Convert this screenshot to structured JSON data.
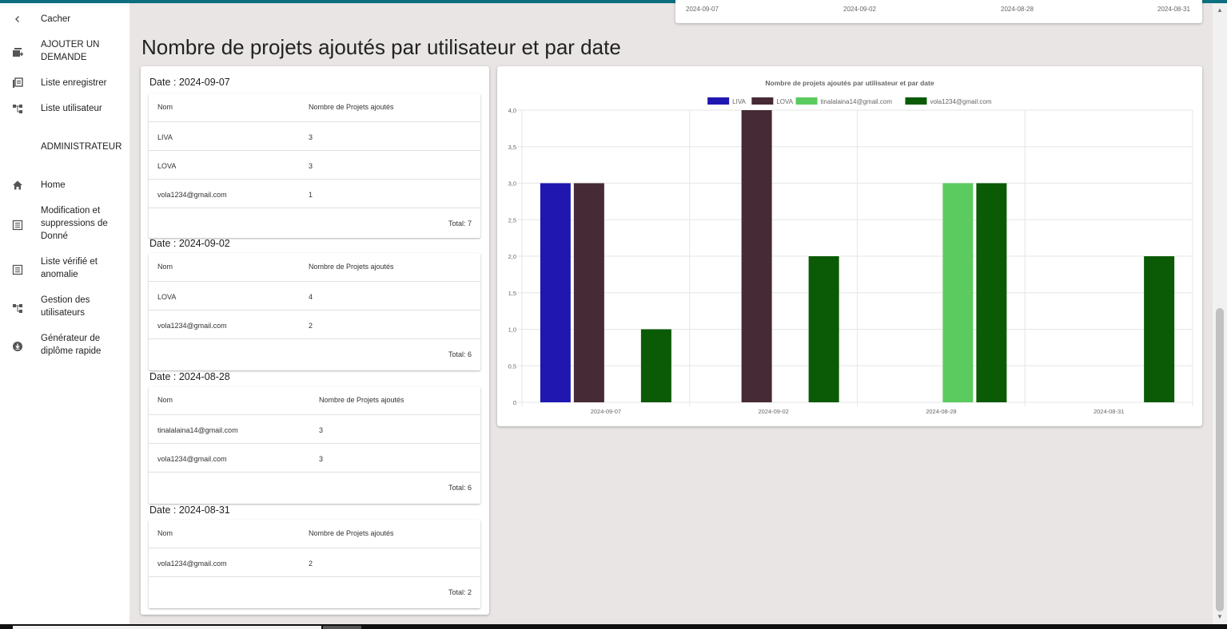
{
  "sidebar": {
    "items": [
      {
        "label": "Cacher",
        "icon": "chevron-left-icon"
      },
      {
        "label": "AJOUTER UN DEMANDE",
        "icon": "add-request-icon"
      },
      {
        "label": "Liste enregistrer",
        "icon": "list-icon"
      },
      {
        "label": "Liste utilisateur",
        "icon": "hierarchy-icon"
      },
      {
        "label": "ADMINISTRATEUR",
        "icon": ""
      },
      {
        "label": "Home",
        "icon": "home-icon"
      },
      {
        "label": "Modification et suppressions de Donné",
        "icon": "edit-list-icon"
      },
      {
        "label": "Liste vérifié et anomalie",
        "icon": "checked-list-icon"
      },
      {
        "label": "Gestion des utilisateurs",
        "icon": "hierarchy-icon"
      },
      {
        "label": "Générateur de diplôme rapide",
        "icon": "download-circle-icon"
      }
    ]
  },
  "prev_card": {
    "dates": [
      "2024-09-07",
      "2024-09-02",
      "2024-08-28",
      "2024-08-31"
    ]
  },
  "main": {
    "title": "Nombre de projets ajoutés par utilisateur et par date"
  },
  "groups": [
    {
      "date_label": "Date : 2024-09-07",
      "col_name": "Nom",
      "col_count": "Nombre de Projets ajoutés",
      "rows": [
        {
          "name": "LIVA",
          "count": "3"
        },
        {
          "name": "LOVA",
          "count": "3"
        },
        {
          "name": "vola1234@gmail.com",
          "count": "1"
        }
      ],
      "total": "Total: 7"
    },
    {
      "date_label": "Date : 2024-09-02",
      "col_name": "Nom",
      "col_count": "Nombre de Projets ajoutés",
      "rows": [
        {
          "name": "LOVA",
          "count": "4"
        },
        {
          "name": "vola1234@gmail.com",
          "count": "2"
        }
      ],
      "total": "Total: 6"
    },
    {
      "date_label": "Date : 2024-08-28",
      "col_name": "Nom",
      "col_count": "Nombre de Projets ajoutés",
      "rows": [
        {
          "name": "tinalalaina14@gmail.com",
          "count": "3"
        },
        {
          "name": "vola1234@gmail.com",
          "count": "3"
        }
      ],
      "total": "Total: 6"
    },
    {
      "date_label": "Date : 2024-08-31",
      "col_name": "Nom",
      "col_count": "Nombre de Projets ajoutés",
      "rows": [
        {
          "name": "vola1234@gmail.com",
          "count": "2"
        }
      ],
      "total": "Total: 2"
    }
  ],
  "chart_data": {
    "type": "bar",
    "title": "Nombre de projets ajoutés par utilisateur et par date",
    "categories": [
      "2024-09-07",
      "2024-09-02",
      "2024-08-28",
      "2024-08-31"
    ],
    "series": [
      {
        "name": "LIVA",
        "color": "#1f17b0",
        "values": [
          3,
          0,
          0,
          0
        ]
      },
      {
        "name": "LOVA",
        "color": "#462a35",
        "values": [
          3,
          4,
          0,
          0
        ]
      },
      {
        "name": "tinalalaina14@gmail.com",
        "color": "#5ccb5f",
        "values": [
          0,
          0,
          3,
          0
        ]
      },
      {
        "name": "vola1234@gmail.com",
        "color": "#0b5a05",
        "values": [
          1,
          2,
          3,
          2
        ]
      }
    ],
    "ylim": [
      0,
      4
    ],
    "yticks": [
      "0",
      "0,5",
      "1,0",
      "1,5",
      "2,0",
      "2,5",
      "3,0",
      "3,5",
      "4,0"
    ],
    "legend": "top",
    "grid": true
  }
}
